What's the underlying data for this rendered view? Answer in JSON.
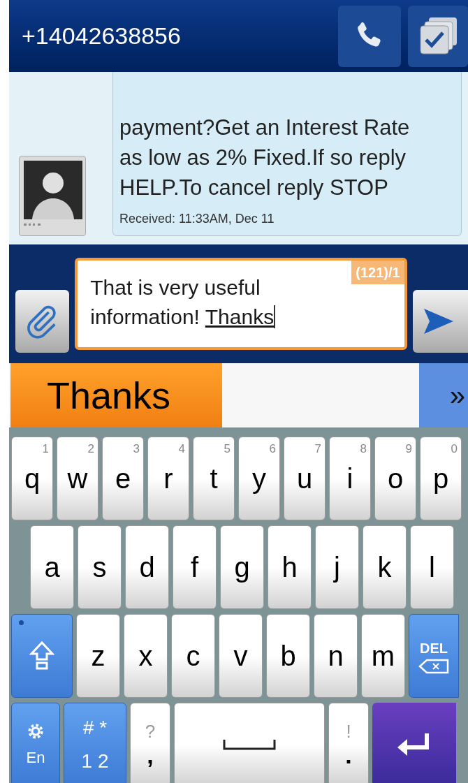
{
  "header": {
    "title": "+14042638856"
  },
  "message": {
    "text": "payment?Get an Interest Rate as low as 2% Fixed.If so reply HELP.To cancel reply STOP",
    "timestamp": "Received: 11:33AM, Dec 11"
  },
  "compose": {
    "text": "That is very useful information!",
    "composing_word": "Thanks",
    "counter": "(121)/1"
  },
  "suggestions": {
    "words": [
      {
        "label": "Thanks",
        "selected": true
      }
    ],
    "more": "»"
  },
  "keyboard": {
    "rows": [
      [
        {
          "kind": "letter",
          "label": "q",
          "hint": "1"
        },
        {
          "kind": "letter",
          "label": "w",
          "hint": "2"
        },
        {
          "kind": "letter",
          "label": "e",
          "hint": "3"
        },
        {
          "kind": "letter",
          "label": "r",
          "hint": "4"
        },
        {
          "kind": "letter",
          "label": "t",
          "hint": "5"
        },
        {
          "kind": "letter",
          "label": "y",
          "hint": "6"
        },
        {
          "kind": "letter",
          "label": "u",
          "hint": "7"
        },
        {
          "kind": "letter",
          "label": "i",
          "hint": "8"
        },
        {
          "kind": "letter",
          "label": "o",
          "hint": "9"
        },
        {
          "kind": "letter",
          "label": "p",
          "hint": "0"
        }
      ],
      [
        {
          "kind": "letter",
          "label": "a"
        },
        {
          "kind": "letter",
          "label": "s"
        },
        {
          "kind": "letter",
          "label": "d"
        },
        {
          "kind": "letter",
          "label": "f"
        },
        {
          "kind": "letter",
          "label": "g"
        },
        {
          "kind": "letter",
          "label": "h"
        },
        {
          "kind": "letter",
          "label": "j"
        },
        {
          "kind": "letter",
          "label": "k"
        },
        {
          "kind": "letter",
          "label": "l"
        }
      ],
      [
        {
          "kind": "shift"
        },
        {
          "kind": "letter",
          "label": "z"
        },
        {
          "kind": "letter",
          "label": "x"
        },
        {
          "kind": "letter",
          "label": "c"
        },
        {
          "kind": "letter",
          "label": "v"
        },
        {
          "kind": "letter",
          "label": "b"
        },
        {
          "kind": "letter",
          "label": "n"
        },
        {
          "kind": "letter",
          "label": "m"
        },
        {
          "kind": "delete",
          "label": "DEL"
        }
      ],
      [
        {
          "kind": "settings",
          "label": "En"
        },
        {
          "kind": "symbols",
          "top": "# *",
          "bottom": "1 2"
        },
        {
          "kind": "punct",
          "top": "?",
          "bottom": ","
        },
        {
          "kind": "space"
        },
        {
          "kind": "punct",
          "top": "!",
          "bottom": "."
        },
        {
          "kind": "enter"
        }
      ]
    ]
  }
}
